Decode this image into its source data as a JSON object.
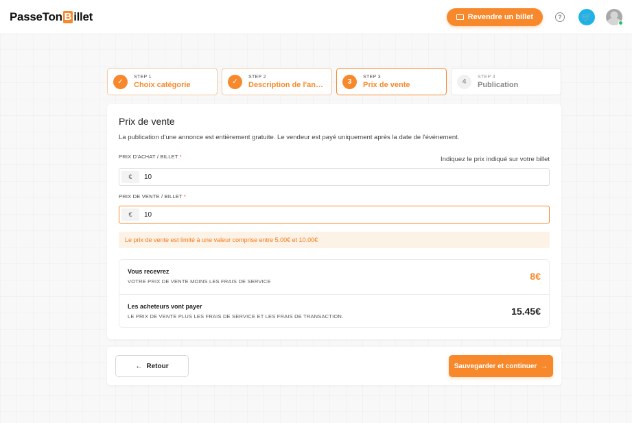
{
  "header": {
    "logo_part1": "PasseTon",
    "logo_b": "B",
    "logo_part2": "illet",
    "resell_label": "Revendre un billet",
    "help_glyph": "?",
    "cart_glyph": "🛒"
  },
  "steps": [
    {
      "num": "STEP 1",
      "label": "Choix catégorie",
      "badge": "✓",
      "state": "done"
    },
    {
      "num": "STEP 2",
      "label": "Description de l'annonce",
      "badge": "✓",
      "state": "done"
    },
    {
      "num": "STEP 3",
      "label": "Prix de vente",
      "badge": "3",
      "state": "active"
    },
    {
      "num": "STEP 4",
      "label": "Publication",
      "badge": "4",
      "state": "pending"
    }
  ],
  "card": {
    "title": "Prix de vente",
    "description": "La publication d'une annonce est entièrement gratuite. Le vendeur est payé uniquement après la date de l'événement.",
    "purchase_label": "PRIX D'ACHAT / BILLET",
    "required_mark": "*",
    "purchase_hint": "Indiquez le prix indiqué sur votre billet",
    "currency": "€",
    "purchase_value": "10",
    "sale_label": "PRIX DE VENTE / BILLET",
    "sale_value": "10",
    "warning": "Le prix de vente est limité à une valeur comprise entre 5.00€ et 10.00€"
  },
  "summary": {
    "receive_title": "Vous recevrez",
    "receive_sub": "VOTRE PRIX DE VENTE MOINS LES FRAIS DE SERVICE",
    "receive_value": "8€",
    "buyers_title": "Les acheteurs vont payer",
    "buyers_sub": "LE PRIX DE VENTE PLUS LES FRAIS DE SERVICE ET LES FRAIS DE TRANSACTION.",
    "buyers_value": "15.45€"
  },
  "footer": {
    "back_arrow": "←",
    "back_label": "Retour",
    "save_label": "Sauvegarder et continuer",
    "save_arrow": "→"
  },
  "colors": {
    "accent": "#f7892c",
    "cart": "#1cb4e8",
    "online": "#22c55e",
    "warning_bg": "#fdf2e6"
  }
}
